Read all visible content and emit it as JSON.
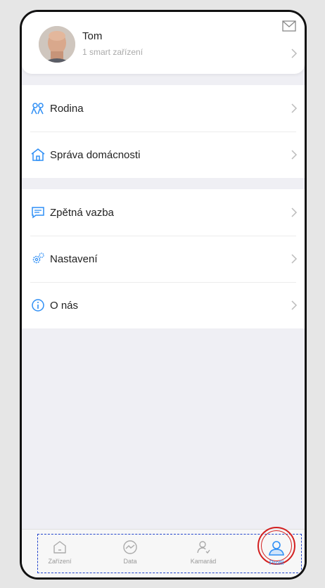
{
  "profile": {
    "name": "Tom",
    "subtitle": "1 smart zařízení"
  },
  "menu_group_1": [
    {
      "label": "Rodina",
      "icon": "family-icon"
    },
    {
      "label": "Správa domácnosti",
      "icon": "home-icon"
    }
  ],
  "menu_group_2": [
    {
      "label": "Zpětná vazba",
      "icon": "feedback-icon"
    },
    {
      "label": "Nastavení",
      "icon": "settings-icon"
    },
    {
      "label": "O nás",
      "icon": "info-icon"
    }
  ],
  "tabbar": {
    "tabs": [
      {
        "label": "Zařízení",
        "icon": "home-outline-icon"
      },
      {
        "label": "Data",
        "icon": "chart-circle-icon"
      },
      {
        "label": "Kamarád",
        "icon": "friend-icon"
      },
      {
        "label": "Profil",
        "icon": "profile-icon",
        "active": true
      }
    ]
  },
  "colors": {
    "accent": "#2f8ff5",
    "background": "#efeff4",
    "highlight_ring": "#d32020"
  }
}
